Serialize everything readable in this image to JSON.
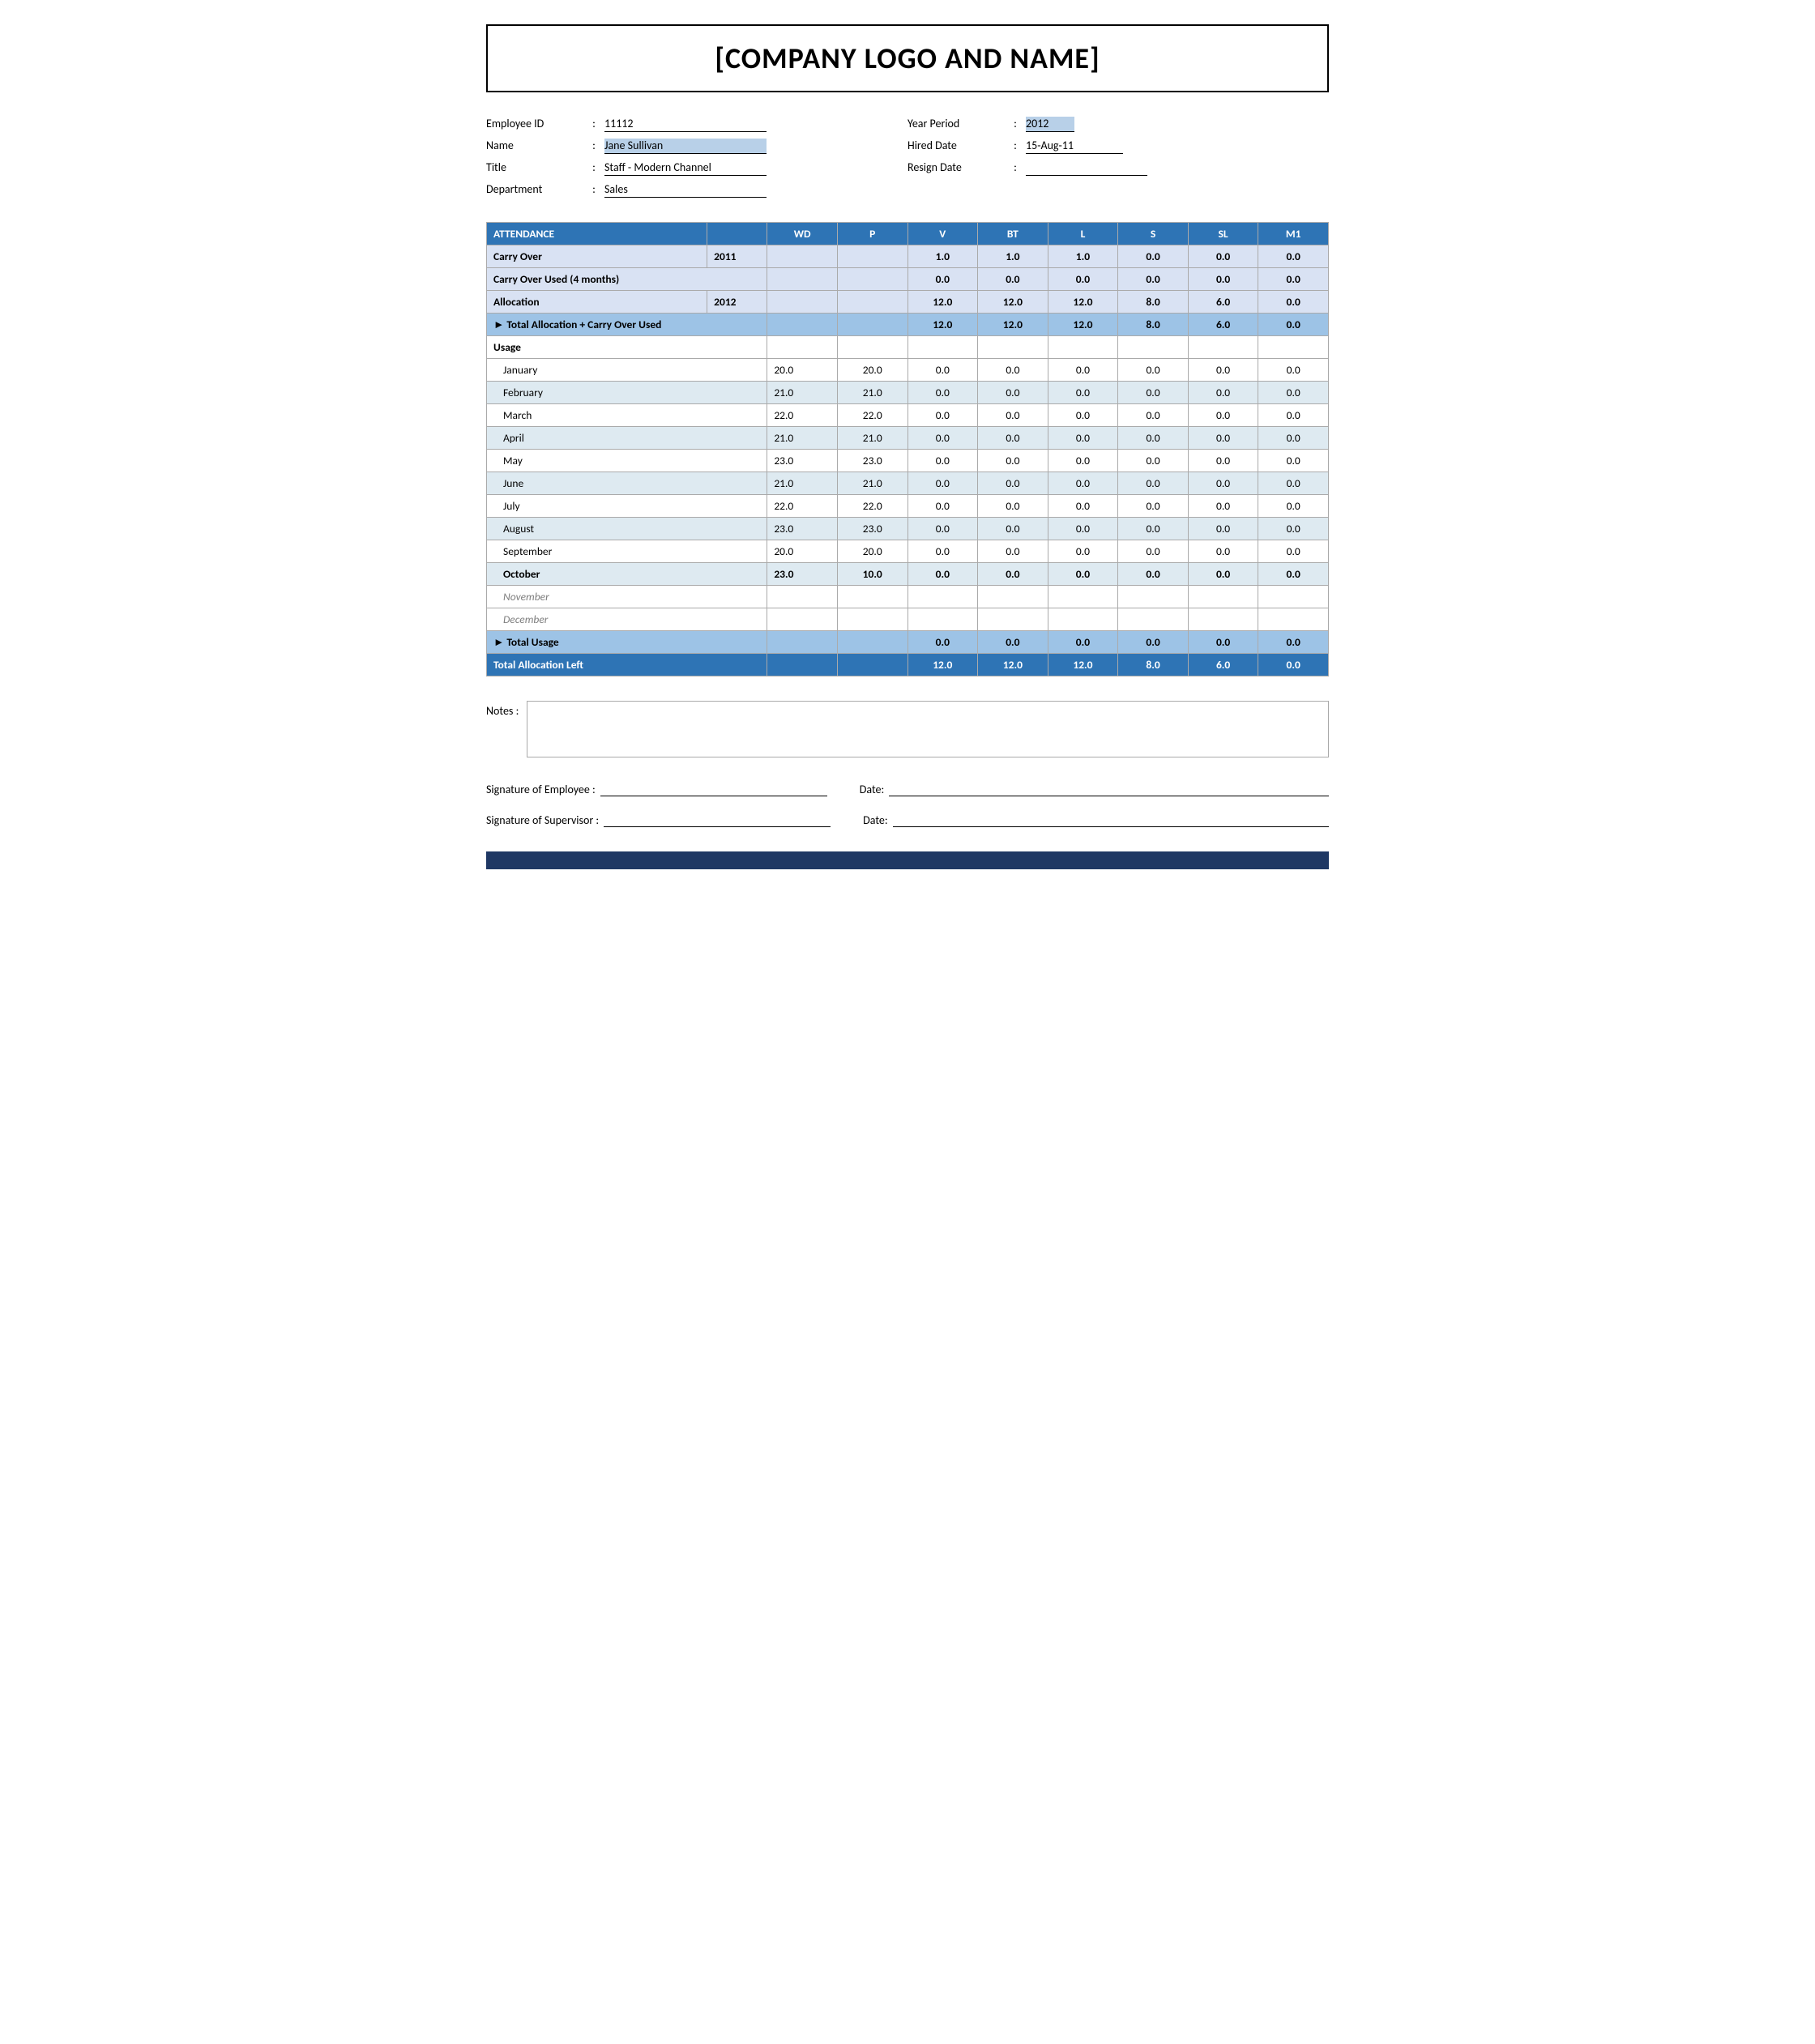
{
  "header": {
    "company_name": "[COMPANY LOGO AND NAME]"
  },
  "employee_info": {
    "left": [
      {
        "label": "Employee ID",
        "value": "11112",
        "highlighted": false,
        "id": "employee-id"
      },
      {
        "label": "Name",
        "value": "Jane Sullivan",
        "highlighted": true,
        "id": "employee-name"
      },
      {
        "label": "Title",
        "value": "Staff - Modern Channel",
        "highlighted": false,
        "id": "employee-title"
      },
      {
        "label": "Department",
        "value": "Sales",
        "highlighted": false,
        "id": "employee-department"
      }
    ],
    "right": [
      {
        "label": "Year Period",
        "value": "2012",
        "highlighted": true,
        "id": "year-period"
      },
      {
        "label": "Hired Date",
        "value": "15-Aug-11",
        "highlighted": false,
        "id": "hired-date"
      },
      {
        "label": "Resign Date",
        "value": "",
        "highlighted": false,
        "id": "resign-date"
      }
    ]
  },
  "attendance": {
    "columns": [
      "ATTENDANCE",
      "",
      "WD",
      "P",
      "V",
      "BT",
      "L",
      "S",
      "SL",
      "M1"
    ],
    "rows": [
      {
        "type": "carry-over",
        "label": "Carry Over",
        "year": "2011",
        "wd": "",
        "p": "",
        "v": "1.0",
        "bt": "1.0",
        "l": "1.0",
        "s": "0.0",
        "sl": "0.0",
        "m1": "0.0"
      },
      {
        "type": "carry-over-used",
        "label": "Carry Over Used (4 months)",
        "year": "",
        "wd": "",
        "p": "",
        "v": "0.0",
        "bt": "0.0",
        "l": "0.0",
        "s": "0.0",
        "sl": "0.0",
        "m1": "0.0"
      },
      {
        "type": "allocation",
        "label": "Allocation",
        "year": "2012",
        "wd": "",
        "p": "",
        "v": "12.0",
        "bt": "12.0",
        "l": "12.0",
        "s": "8.0",
        "sl": "6.0",
        "m1": "0.0"
      },
      {
        "type": "total-alloc",
        "label": "► Total Allocation + Carry Over Used",
        "year": "",
        "wd": "",
        "p": "",
        "v": "12.0",
        "bt": "12.0",
        "l": "12.0",
        "s": "8.0",
        "sl": "6.0",
        "m1": "0.0"
      },
      {
        "type": "usage-header",
        "label": "Usage",
        "year": "",
        "wd": "",
        "p": "",
        "v": "",
        "bt": "",
        "l": "",
        "s": "",
        "sl": "",
        "m1": ""
      },
      {
        "type": "month",
        "label": "January",
        "year": "",
        "wd": "20.0",
        "p": "20.0",
        "v": "0.0",
        "bt": "0.0",
        "l": "0.0",
        "s": "0.0",
        "sl": "0.0",
        "m1": "0.0"
      },
      {
        "type": "month-alt",
        "label": "February",
        "year": "",
        "wd": "21.0",
        "p": "21.0",
        "v": "0.0",
        "bt": "0.0",
        "l": "0.0",
        "s": "0.0",
        "sl": "0.0",
        "m1": "0.0"
      },
      {
        "type": "month",
        "label": "March",
        "year": "",
        "wd": "22.0",
        "p": "22.0",
        "v": "0.0",
        "bt": "0.0",
        "l": "0.0",
        "s": "0.0",
        "sl": "0.0",
        "m1": "0.0"
      },
      {
        "type": "month-alt",
        "label": "April",
        "year": "",
        "wd": "21.0",
        "p": "21.0",
        "v": "0.0",
        "bt": "0.0",
        "l": "0.0",
        "s": "0.0",
        "sl": "0.0",
        "m1": "0.0"
      },
      {
        "type": "month",
        "label": "May",
        "year": "",
        "wd": "23.0",
        "p": "23.0",
        "v": "0.0",
        "bt": "0.0",
        "l": "0.0",
        "s": "0.0",
        "sl": "0.0",
        "m1": "0.0"
      },
      {
        "type": "month-alt",
        "label": "June",
        "year": "",
        "wd": "21.0",
        "p": "21.0",
        "v": "0.0",
        "bt": "0.0",
        "l": "0.0",
        "s": "0.0",
        "sl": "0.0",
        "m1": "0.0"
      },
      {
        "type": "month",
        "label": "July",
        "year": "",
        "wd": "22.0",
        "p": "22.0",
        "v": "0.0",
        "bt": "0.0",
        "l": "0.0",
        "s": "0.0",
        "sl": "0.0",
        "m1": "0.0"
      },
      {
        "type": "month-alt",
        "label": "August",
        "year": "",
        "wd": "23.0",
        "p": "23.0",
        "v": "0.0",
        "bt": "0.0",
        "l": "0.0",
        "s": "0.0",
        "sl": "0.0",
        "m1": "0.0"
      },
      {
        "type": "month",
        "label": "September",
        "year": "",
        "wd": "20.0",
        "p": "20.0",
        "v": "0.0",
        "bt": "0.0",
        "l": "0.0",
        "s": "0.0",
        "sl": "0.0",
        "m1": "0.0"
      },
      {
        "type": "october",
        "label": "October",
        "year": "",
        "wd": "23.0",
        "p": "10.0",
        "v": "0.0",
        "bt": "0.0",
        "l": "0.0",
        "s": "0.0",
        "sl": "0.0",
        "m1": "0.0"
      },
      {
        "type": "future",
        "label": "November",
        "year": "",
        "wd": "",
        "p": "",
        "v": "",
        "bt": "",
        "l": "",
        "s": "",
        "sl": "",
        "m1": ""
      },
      {
        "type": "future",
        "label": "December",
        "year": "",
        "wd": "",
        "p": "",
        "v": "",
        "bt": "",
        "l": "",
        "s": "",
        "sl": "",
        "m1": ""
      },
      {
        "type": "total-usage",
        "label": "► Total Usage",
        "year": "",
        "wd": "",
        "p": "",
        "v": "0.0",
        "bt": "0.0",
        "l": "0.0",
        "s": "0.0",
        "sl": "0.0",
        "m1": "0.0"
      },
      {
        "type": "total-alloc-left",
        "label": "Total Allocation Left",
        "year": "",
        "wd": "",
        "p": "",
        "v": "12.0",
        "bt": "12.0",
        "l": "12.0",
        "s": "8.0",
        "sl": "6.0",
        "m1": "0.0"
      }
    ]
  },
  "notes": {
    "label": "Notes :"
  },
  "signatures": {
    "employee_label": "Signature of Employee :",
    "supervisor_label": "Signature of Supervisor :",
    "date_label": "Date:"
  }
}
